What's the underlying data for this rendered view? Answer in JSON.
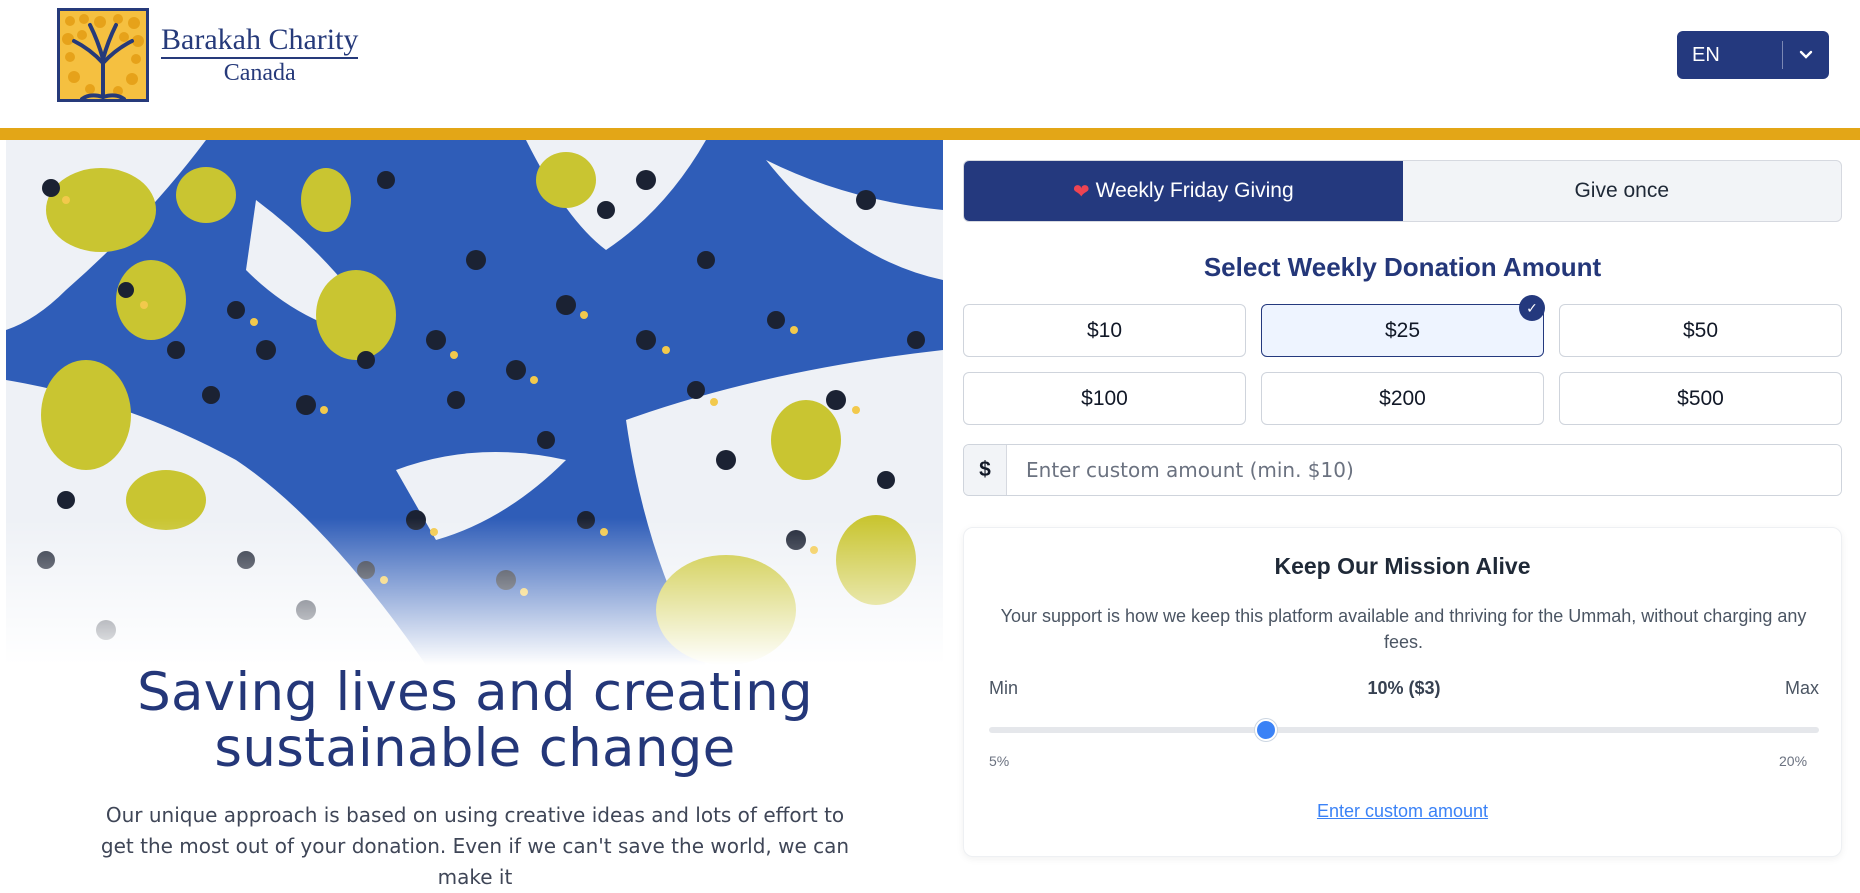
{
  "header": {
    "logo_title": "Barakah Charity",
    "logo_subtitle": "Canada",
    "language": {
      "selected": "EN",
      "icon": "chevron-down-icon"
    }
  },
  "hero": {
    "image_alt": "",
    "headline": "Saving lives and creating sustainable change",
    "intro": "Our unique approach is based on using creative ideas and lots of effort to get the most out of your donation. Even if we can't save the world, we can make it"
  },
  "donation": {
    "tabs": [
      {
        "label": "Weekly Friday Giving",
        "active": true,
        "icon": "heart-icon"
      },
      {
        "label": "Give once",
        "active": false
      }
    ],
    "title": "Select Weekly Donation Amount",
    "amounts": [
      {
        "label": "$10",
        "selected": false
      },
      {
        "label": "$25",
        "selected": true
      },
      {
        "label": "$50",
        "selected": false
      },
      {
        "label": "$100",
        "selected": false
      },
      {
        "label": "$200",
        "selected": false
      },
      {
        "label": "$500",
        "selected": false
      }
    ],
    "custom": {
      "prefix": "$",
      "placeholder": "Enter custom amount (min. $10)",
      "value": ""
    }
  },
  "mission": {
    "title": "Keep Our Mission Alive",
    "text": "Your support is how we keep this platform available and thriving for the Ummah, without charging any fees.",
    "slider": {
      "min_label": "Min",
      "max_label": "Max",
      "current_label": "10% ($3)",
      "min_tick": "5%",
      "max_tick": "20%",
      "min_value": 5,
      "max_value": 20,
      "value": 10
    },
    "custom_link": "Enter custom amount"
  },
  "colors": {
    "navy": "#24397e",
    "gold": "#e3a617",
    "accent_blue": "#3b82f6",
    "heart": "#ef4452"
  }
}
